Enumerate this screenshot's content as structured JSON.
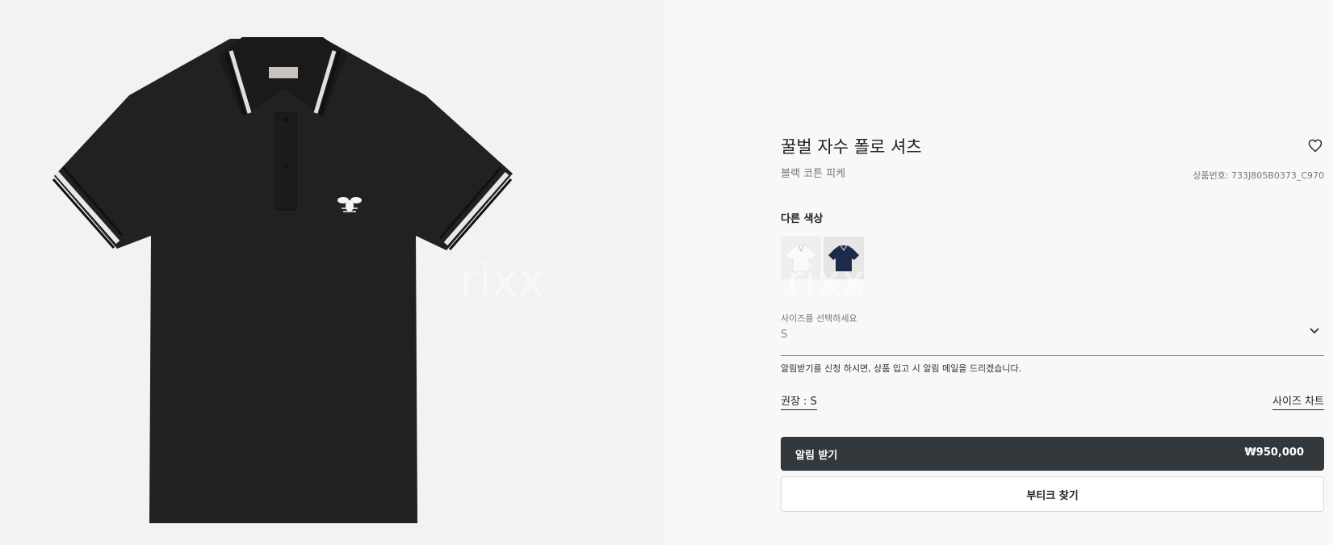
{
  "product": {
    "title": "꿀벌 자수 폴로 셔츠",
    "subtitle": "블랙 코튼 피케",
    "product_number": "상품번호: 733J805B0373_C970",
    "image_alt": "black polo shirt with bee embroidery",
    "watermark": "rixx"
  },
  "colors": {
    "label": "다른 색상",
    "swatches": [
      "white",
      "navy"
    ]
  },
  "size": {
    "label": "사이즈를 선택하세요",
    "value": "S",
    "notice": "알림받기를 신청 하시면, 상품 입고 시 알림 메일을 드리겠습니다.",
    "recommended": "권장 : S",
    "chart_link": "사이즈 차트"
  },
  "actions": {
    "notify_label": "알림 받기",
    "price": "₩950,000",
    "find_boutique": "부티크 찾기"
  },
  "colors_theme": {
    "left_panel_bg": "#f2f2f2",
    "right_panel_bg": "#f8f8f8",
    "primary_button": "#33383c",
    "shirt": "#212121",
    "navy_swatch": "#1d2b4a"
  },
  "icons": [
    "heart-icon",
    "chevron-down-icon"
  ]
}
